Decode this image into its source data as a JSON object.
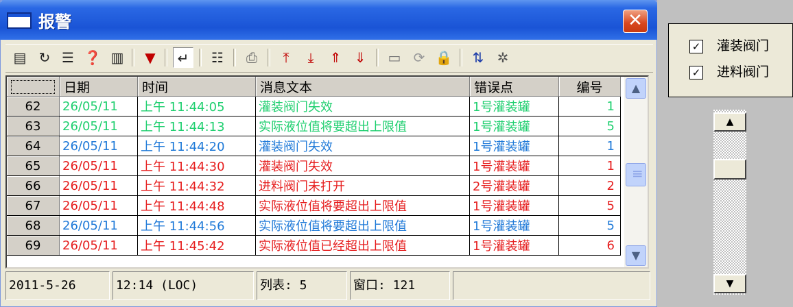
{
  "window": {
    "title": "报警",
    "close_label": "✕"
  },
  "toolbar": {
    "icons": [
      "list-icon",
      "refresh-icon",
      "align-icon",
      "info-icon",
      "chart-icon",
      "filter-icon",
      "acknowledge-icon",
      "options-icon",
      "print-icon",
      "first-icon",
      "last-icon",
      "prev-icon",
      "next-icon",
      "window-icon",
      "reload-icon",
      "lock-icon",
      "sort-icon",
      "settings-icon"
    ]
  },
  "grid": {
    "columns": [
      "",
      "日期",
      "时间",
      "消息文本",
      "错误点",
      "编号"
    ],
    "rows": [
      {
        "num": "62",
        "date": "26/05/11",
        "time": "上午  11:44:05",
        "message": "灌装阀门失效",
        "point": "1号灌装罐",
        "code": "1",
        "color": "green"
      },
      {
        "num": "63",
        "date": "26/05/11",
        "time": "上午  11:44:13",
        "message": "实际液位值将要超出上限值",
        "point": "1号灌装罐",
        "code": "5",
        "color": "green"
      },
      {
        "num": "64",
        "date": "26/05/11",
        "time": "上午  11:44:20",
        "message": "灌装阀门失效",
        "point": "1号灌装罐",
        "code": "1",
        "color": "blue"
      },
      {
        "num": "65",
        "date": "26/05/11",
        "time": "上午  11:44:30",
        "message": "灌装阀门失效",
        "point": "1号灌装罐",
        "code": "1",
        "color": "red"
      },
      {
        "num": "66",
        "date": "26/05/11",
        "time": "上午  11:44:32",
        "message": "进料阀门未打开",
        "point": "2号灌装罐",
        "code": "2",
        "color": "red"
      },
      {
        "num": "67",
        "date": "26/05/11",
        "time": "上午  11:44:48",
        "message": "实际液位值将要超出上限值",
        "point": "1号灌装罐",
        "code": "5",
        "color": "red"
      },
      {
        "num": "68",
        "date": "26/05/11",
        "time": "上午  11:44:56",
        "message": "实际液位值将要超出上限值",
        "point": "1号灌装罐",
        "code": "5",
        "color": "blue"
      },
      {
        "num": "69",
        "date": "26/05/11",
        "time": "上午  11:45:42",
        "message": "实际液位值已经超出上限值",
        "point": "1号灌装罐",
        "code": "6",
        "color": "red"
      }
    ],
    "scroll_up": "▲",
    "scroll_down": "▼"
  },
  "status": {
    "date": "2011-5-26",
    "time": "12:14 (LOC)",
    "list": "列表: 5",
    "window": "窗口: 121",
    "extra": ""
  },
  "filters": {
    "items": [
      {
        "label": "灌装阀门",
        "checked": true
      },
      {
        "label": "进料阀门",
        "checked": true
      }
    ]
  },
  "right_scroll": {
    "up": "▲",
    "down": "▼"
  },
  "colors": {
    "green": "#1fcf6f",
    "blue": "#1f7ad8",
    "red": "#e61e1e"
  }
}
